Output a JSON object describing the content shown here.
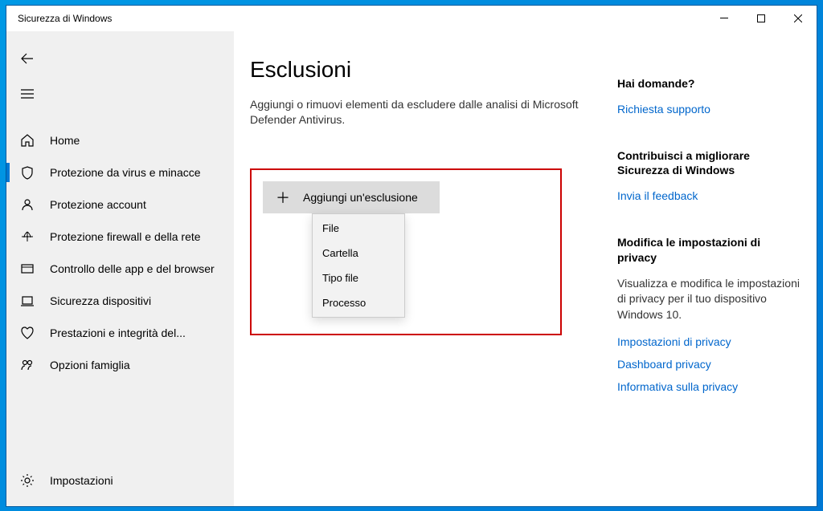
{
  "window": {
    "title": "Sicurezza di Windows"
  },
  "sidebar": {
    "items": [
      {
        "label": "Home",
        "icon": "home"
      },
      {
        "label": "Protezione da virus e minacce",
        "icon": "shield",
        "active": true
      },
      {
        "label": "Protezione account",
        "icon": "account"
      },
      {
        "label": "Protezione firewall e della rete",
        "icon": "firewall"
      },
      {
        "label": "Controllo delle app e del browser",
        "icon": "app"
      },
      {
        "label": "Sicurezza dispositivi",
        "icon": "device"
      },
      {
        "label": "Prestazioni e integrità del...",
        "icon": "health"
      },
      {
        "label": "Opzioni famiglia",
        "icon": "family"
      }
    ],
    "footer": {
      "label": "Impostazioni",
      "icon": "settings"
    }
  },
  "main": {
    "title": "Esclusioni",
    "description": "Aggiungi o rimuovi elementi da escludere dalle analisi di Microsoft Defender Antivirus.",
    "add_button": "Aggiungi un'esclusione",
    "dropdown": [
      "File",
      "Cartella",
      "Tipo file",
      "Processo"
    ]
  },
  "right": {
    "sections": [
      {
        "heading": "Hai domande?",
        "links": [
          "Richiesta supporto"
        ]
      },
      {
        "heading": "Contribuisci a migliorare Sicurezza di Windows",
        "links": [
          "Invia il feedback"
        ]
      },
      {
        "heading": "Modifica le impostazioni di privacy",
        "text": "Visualizza e modifica le impostazioni di privacy per il tuo dispositivo Windows 10.",
        "links": [
          "Impostazioni di privacy",
          "Dashboard privacy",
          "Informativa sulla privacy"
        ]
      }
    ]
  }
}
